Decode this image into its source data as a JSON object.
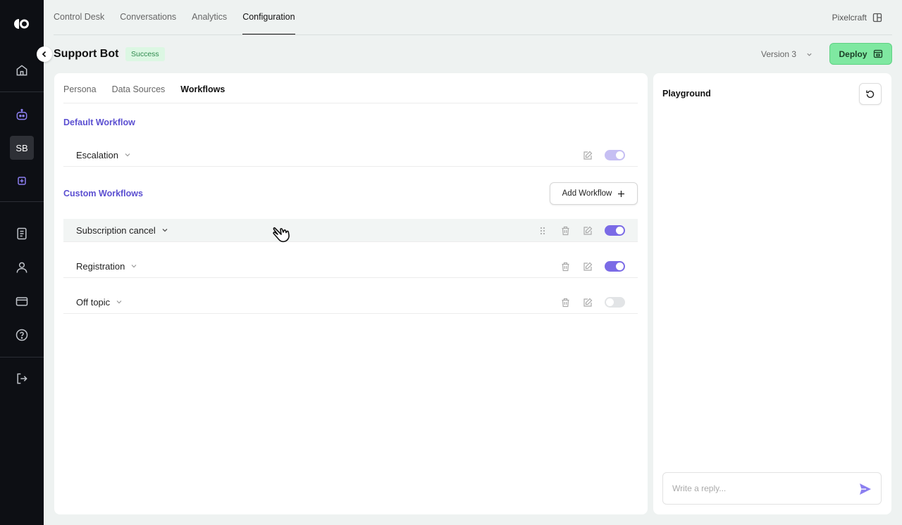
{
  "sidebar": {
    "avatar_initials": "SB",
    "icons": [
      "logo-icon",
      "home-icon",
      "bot-icon",
      "add-square-icon",
      "document-icon",
      "user-icon",
      "card-icon",
      "help-icon",
      "logout-icon"
    ]
  },
  "topnav": {
    "tabs": [
      {
        "label": "Control Desk",
        "active": false
      },
      {
        "label": "Conversations",
        "active": false
      },
      {
        "label": "Analytics",
        "active": false
      },
      {
        "label": "Configuration",
        "active": true
      }
    ],
    "org_name": "Pixelcraft"
  },
  "header": {
    "bot_name": "Support Bot",
    "status": "Success",
    "version": "Version 3",
    "deploy_label": "Deploy"
  },
  "config": {
    "sub_tabs": [
      {
        "label": "Persona",
        "active": false
      },
      {
        "label": "Data Sources",
        "active": false
      },
      {
        "label": "Workflows",
        "active": true
      }
    ],
    "default_title": "Default Workflow",
    "default_workflows": [
      {
        "name": "Escalation",
        "enabled": true
      }
    ],
    "custom_title": "Custom Workflows",
    "add_workflow_label": "Add Workflow",
    "custom_workflows": [
      {
        "name": "Subscription cancel",
        "enabled": true
      },
      {
        "name": "Registration",
        "enabled": true
      },
      {
        "name": "Off topic",
        "enabled": false
      }
    ]
  },
  "playground": {
    "title": "Playground",
    "reply_placeholder": "Write a reply..."
  },
  "colors": {
    "accent": "#7b6be6",
    "section_title": "#5b4fd1",
    "deploy_bg": "#7fe8a1",
    "status_bg": "#dcf7e3",
    "sidebar_bg": "#0d0f14"
  }
}
